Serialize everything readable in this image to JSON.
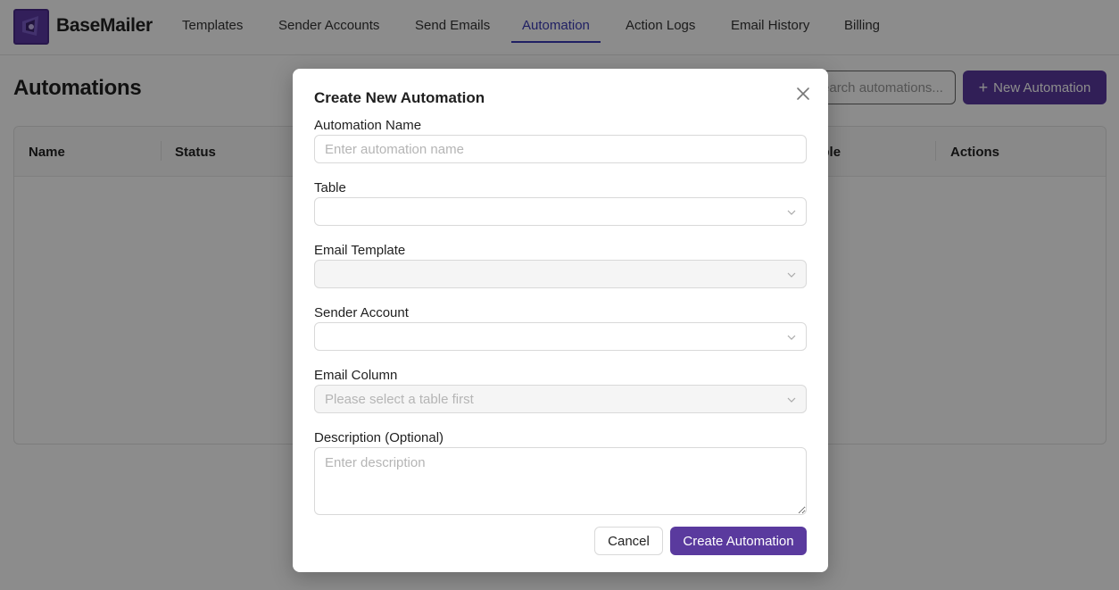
{
  "app": {
    "brand": "BaseMailer"
  },
  "nav": {
    "items": [
      {
        "label": "Templates"
      },
      {
        "label": "Sender Accounts"
      },
      {
        "label": "Send Emails"
      },
      {
        "label": "Automation",
        "active": true
      },
      {
        "label": "Action Logs"
      },
      {
        "label": "Email History"
      },
      {
        "label": "Billing"
      }
    ]
  },
  "page": {
    "title": "Automations",
    "search_placeholder": "Search automations...",
    "new_button_label": "New Automation"
  },
  "table": {
    "columns": [
      "Name",
      "Status",
      "Table",
      "Actions"
    ]
  },
  "modal": {
    "title": "Create New Automation",
    "fields": {
      "name_label": "Automation Name",
      "name_placeholder": "Enter automation name",
      "table_label": "Table",
      "template_label": "Email Template",
      "sender_label": "Sender Account",
      "column_label": "Email Column",
      "column_placeholder": "Please select a table first",
      "description_label": "Description (Optional)",
      "description_placeholder": "Enter description"
    },
    "cancel_label": "Cancel",
    "create_label": "Create Automation"
  },
  "colors": {
    "accent": "#5a3a9e",
    "nav_active": "#3b3bb5"
  }
}
